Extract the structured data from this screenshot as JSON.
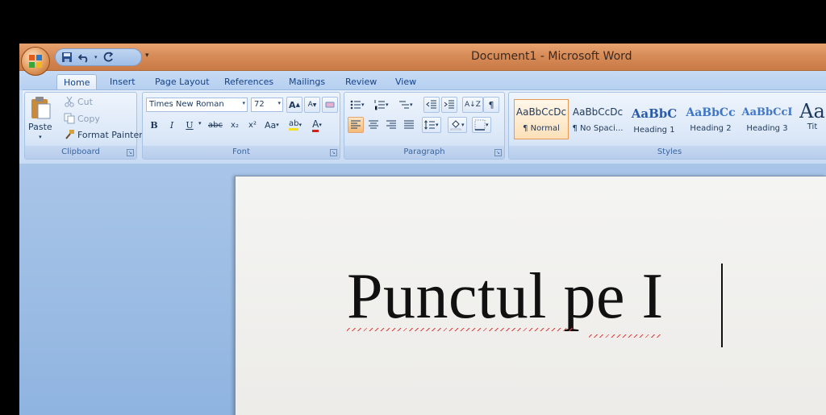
{
  "window": {
    "title": "Document1 - Microsoft Word"
  },
  "tabs": [
    "Home",
    "Insert",
    "Page Layout",
    "References",
    "Mailings",
    "Review",
    "View"
  ],
  "clipboard": {
    "label": "Clipboard",
    "paste": "Paste",
    "cut": "Cut",
    "copy": "Copy",
    "format_painter": "Format Painter"
  },
  "font": {
    "label": "Font",
    "name": "Times New Roman",
    "size": "72",
    "grow": "A",
    "shrink": "A",
    "bold": "B",
    "italic": "I",
    "underline": "U",
    "strike": "abc",
    "subscript": "x₂",
    "superscript": "x²",
    "change_case": "Aa",
    "highlight": "ab",
    "font_color": "A"
  },
  "paragraph": {
    "label": "Paragraph",
    "sort": "A↓Z",
    "pilcrow": "¶"
  },
  "styles": {
    "label": "Styles",
    "items": [
      {
        "sample": "AaBbCcDc",
        "name": "¶ Normal"
      },
      {
        "sample": "AaBbCcDc",
        "name": "¶ No Spaci..."
      },
      {
        "sample": "AaBbC",
        "name": "Heading 1"
      },
      {
        "sample": "AaBbCc",
        "name": "Heading 2"
      },
      {
        "sample": "AaBbCcI",
        "name": "Heading 3"
      },
      {
        "sample": "Aa",
        "name": "Tit"
      }
    ]
  },
  "document": {
    "text": "Punctul pe  I"
  },
  "colors": {
    "titlebar": "#d78c58",
    "ribbon": "#d4e3f6",
    "accent_text": "#15428b",
    "spellcheck": "#e04040"
  }
}
